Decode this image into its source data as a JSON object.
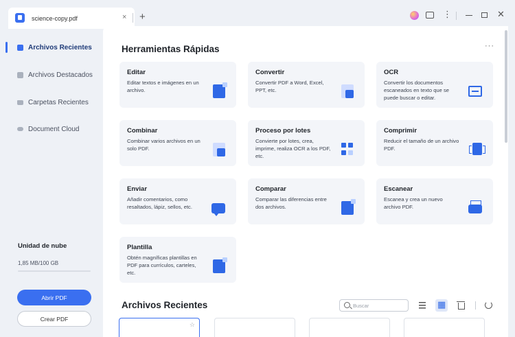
{
  "titlebar": {
    "tab_title": "science-copy.pdf",
    "tab_close": "×",
    "tab_add": "+",
    "more": "⋮",
    "close": "✕"
  },
  "sidebar": {
    "items": [
      {
        "label": "Archivos Recientes",
        "icon": "recent-files-icon",
        "active": true
      },
      {
        "label": "Archivos Destacados",
        "icon": "star-files-icon",
        "active": false
      },
      {
        "label": "Carpetas Recientes",
        "icon": "folder-icon",
        "active": false
      },
      {
        "label": "Document Cloud",
        "icon": "cloud-icon",
        "active": false
      }
    ],
    "cloud": {
      "label": "Unidad de nube",
      "storage": "1,85 MB/100 GB",
      "used_fraction": 0.0
    },
    "open_button": "Abrir PDF",
    "create_button": "Crear PDF"
  },
  "quick_tools": {
    "title": "Herramientas Rápidas",
    "more": "···",
    "cards": [
      {
        "title": "Editar",
        "desc": "Editar textos e imágenes en un archivo.",
        "icon": "edit-doc-icon"
      },
      {
        "title": "Convertir",
        "desc": "Convertir PDF a Word, Excel, PPT, etc.",
        "icon": "convert-icon"
      },
      {
        "title": "OCR",
        "desc": "Convertir los documentos escaneados en texto que se puede buscar o editar.",
        "icon": "ocr-scan-icon"
      },
      {
        "title": "Combinar",
        "desc": "Combinar varios archivos en un solo PDF.",
        "icon": "combine-icon"
      },
      {
        "title": "Proceso por lotes",
        "desc": "Convierte por lotes, crea, imprime, realiza OCR a los PDF, etc.",
        "icon": "batch-icon"
      },
      {
        "title": "Comprimir",
        "desc": "Reducir el tamaño de un archivo PDF.",
        "icon": "compress-icon"
      },
      {
        "title": "Enviar",
        "desc": "Añadir comentarios, como resaltados, lápiz, sellos, etc.",
        "icon": "comment-icon"
      },
      {
        "title": "Comparar",
        "desc": "Comparar las diferencias entre dos archivos.",
        "icon": "compare-icon"
      },
      {
        "title": "Escanear",
        "desc": "Escanea y crea un nuevo archivo PDF.",
        "icon": "scanner-icon"
      },
      {
        "title": "Plantilla",
        "desc": "Obtén magníficas plantillas en PDF para currículos, carteles, etc.",
        "icon": "template-icon"
      }
    ]
  },
  "recent": {
    "title": "Archivos Recientes",
    "search_placeholder": "Buscar",
    "star": "☆"
  }
}
